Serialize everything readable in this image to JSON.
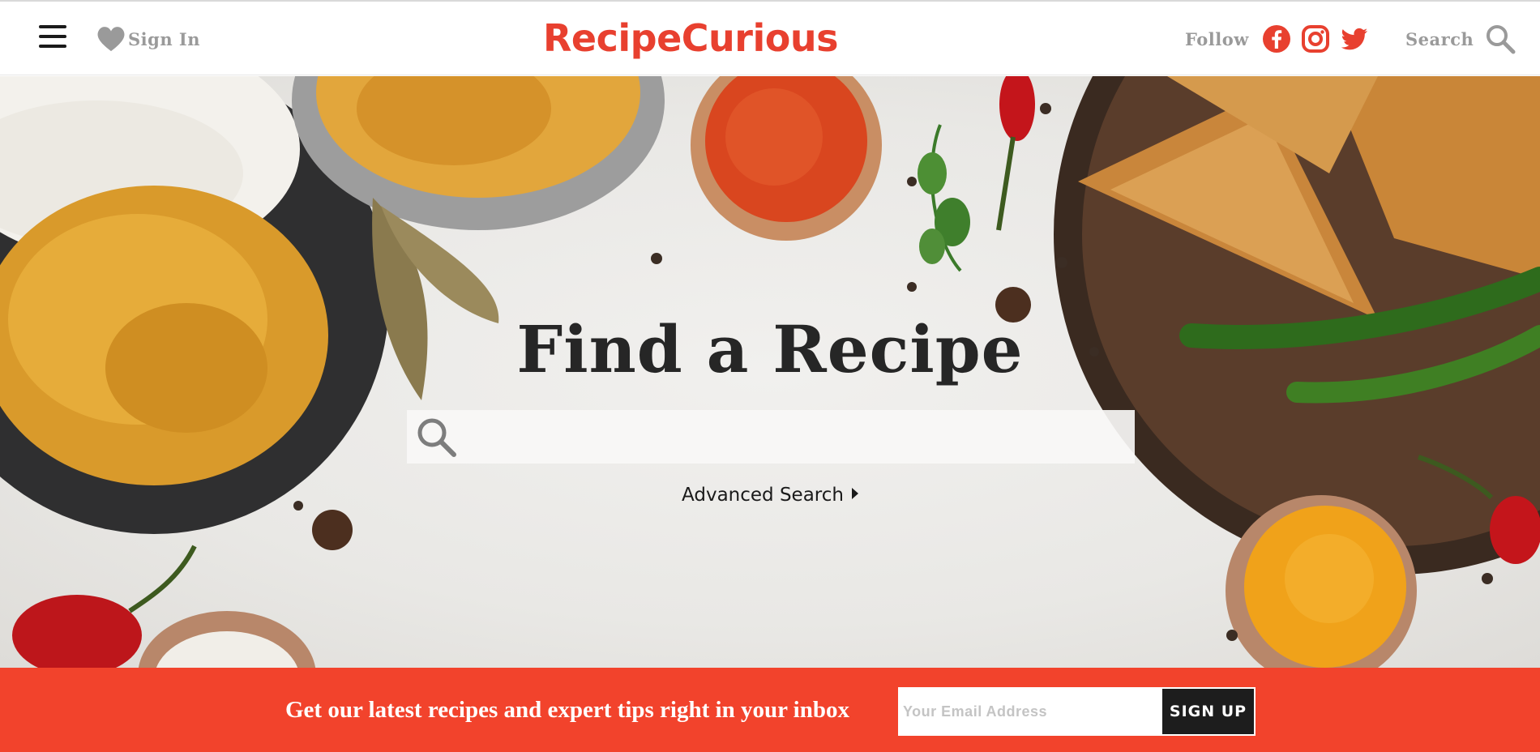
{
  "header": {
    "sign_in_label": "Sign In",
    "logo_text": "RecipeCurious",
    "follow_label": "Follow",
    "social": [
      "facebook-icon",
      "instagram-icon",
      "twitter-icon"
    ],
    "search_label": "Search"
  },
  "hero": {
    "title": "Find a Recipe",
    "search_placeholder": "",
    "advanced_search_label": "Advanced Search"
  },
  "newsletter": {
    "text": "Get our latest recipes and expert tips right in your inbox",
    "email_placeholder": "Your Email Address",
    "signup_label": "SIGN UP"
  },
  "colors": {
    "brand_red": "#e8402f",
    "newsletter_bg": "#f2432c",
    "signup_bg": "#1d1d1d",
    "muted_text": "#9a9a9a"
  }
}
